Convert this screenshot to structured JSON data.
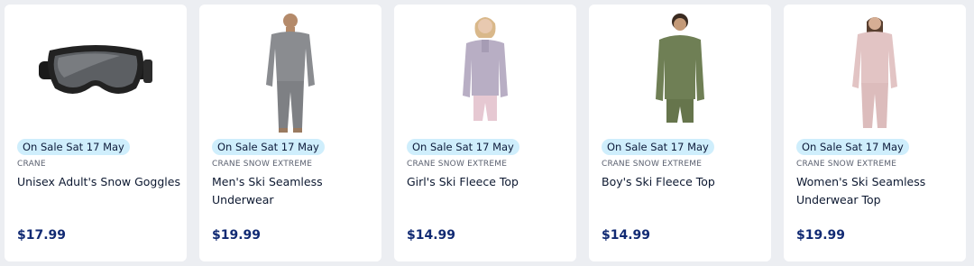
{
  "products": [
    {
      "badge": "On Sale Sat 17 May",
      "brand": "CRANE",
      "title": "Unisex Adult's Snow Goggles",
      "price": "$17.99",
      "image": "snow-goggles",
      "color": "#2a2a2a"
    },
    {
      "badge": "On Sale Sat 17 May",
      "brand": "CRANE SNOW EXTREME",
      "title": "Men's Ski Seamless Underwear",
      "price": "$19.99",
      "image": "mens-thermal",
      "color": "#8a8c90"
    },
    {
      "badge": "On Sale Sat 17 May",
      "brand": "CRANE SNOW EXTREME",
      "title": "Girl's Ski Fleece Top",
      "price": "$14.99",
      "image": "girls-fleece",
      "color": "#b8aec4"
    },
    {
      "badge": "On Sale Sat 17 May",
      "brand": "CRANE SNOW EXTREME",
      "title": "Boy's Ski Fleece Top",
      "price": "$14.99",
      "image": "boys-fleece",
      "color": "#6f7f55"
    },
    {
      "badge": "On Sale Sat 17 May",
      "brand": "CRANE SNOW EXTREME",
      "title": "Women's Ski Seamless Underwear Top",
      "price": "$19.99",
      "image": "womens-thermal",
      "color": "#e2c4c4"
    }
  ],
  "colors": {
    "badge_bg": "#cfeefc",
    "price": "#112a73",
    "page_bg": "#eceef2"
  }
}
